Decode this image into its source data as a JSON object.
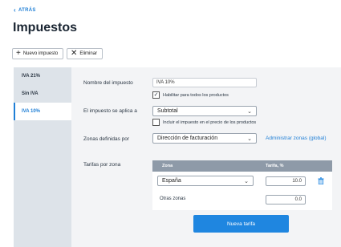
{
  "back": {
    "label": "ATRÁS"
  },
  "page": {
    "title": "Impuestos"
  },
  "toolbar": {
    "new_label": "Nuevo impuesto",
    "delete_label": "Eliminar"
  },
  "sidebar": {
    "items": [
      {
        "label": "IVA 21%",
        "active": false
      },
      {
        "label": "Sin IVA",
        "active": false
      },
      {
        "label": "IVA 10%",
        "active": true
      }
    ]
  },
  "form": {
    "name_label": "Nombre del impuesto",
    "name_value": "IVA 10%",
    "enable_all_label": "Habilitar para todos los productos",
    "enable_all_checked": true,
    "applies_label": "El impuesto se aplica a",
    "applies_value": "Subtotal",
    "include_price_label": "Incluir el impuesto en el precio de los productos",
    "include_price_checked": false,
    "zones_label": "Zonas definidas por",
    "zones_value": "Dirección de facturación",
    "manage_zones_link": "Administrar zonas (global)",
    "rates_label": "Tarifas por zona"
  },
  "rates_table": {
    "col_zone": "Zona",
    "col_rate": "Tarifa, %",
    "rows": [
      {
        "zone": "España",
        "rate": "10.0"
      },
      {
        "zone": "Otras zonas",
        "rate": "0.0"
      }
    ]
  },
  "new_rate_button": "Nueva tarifa",
  "colors": {
    "accent": "#1f86e0",
    "sidebar_bg": "#dde3e9",
    "table_head": "#8e9aa8"
  }
}
